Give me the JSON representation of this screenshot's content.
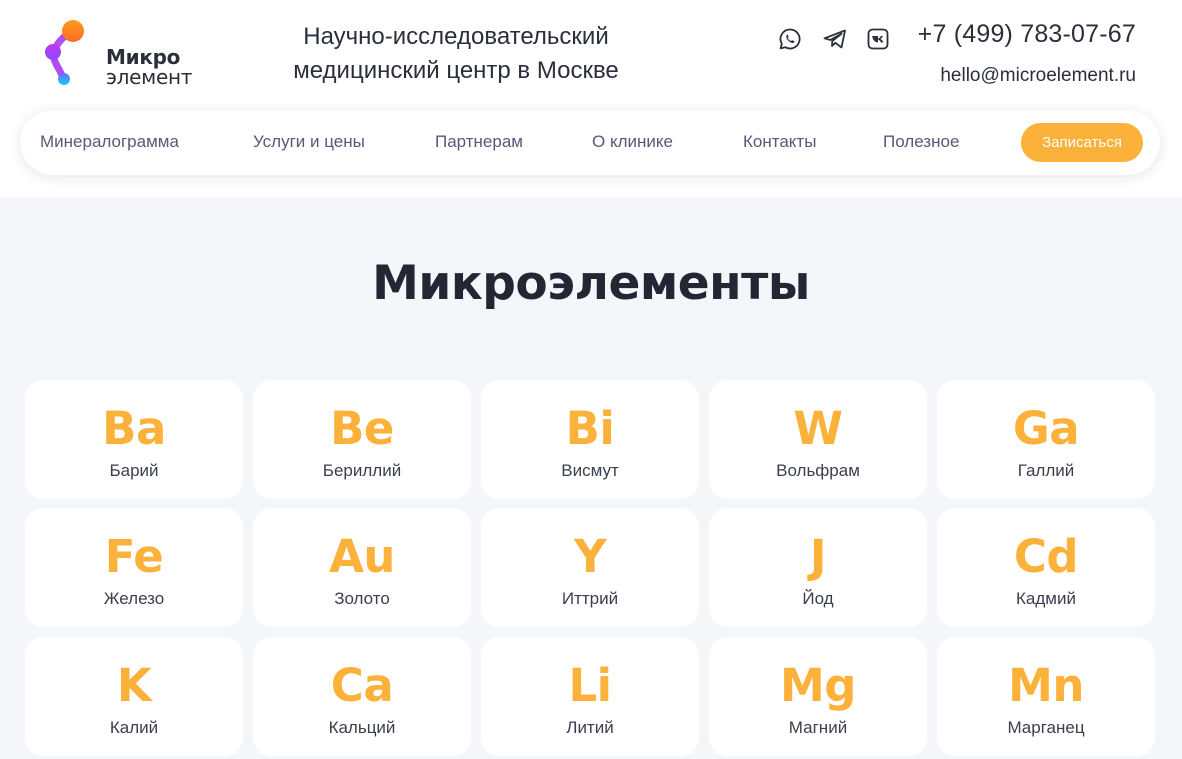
{
  "header": {
    "logo": {
      "line1": "Микро",
      "line2": "элемент"
    },
    "tagline_line1": "Научно-исследовательский",
    "tagline_line2": "медицинский центр в Москве",
    "socials": [
      {
        "icon": "whatsapp-icon"
      },
      {
        "icon": "telegram-icon"
      },
      {
        "icon": "vk-icon"
      }
    ],
    "phone": "+7 (499) 783-07-67",
    "email": "hello@microelement.ru"
  },
  "nav": {
    "items": [
      {
        "label": "Минералограмма"
      },
      {
        "label": "Услуги и цены"
      },
      {
        "label": "Партнерам"
      },
      {
        "label": "О клинике"
      },
      {
        "label": "Контакты"
      },
      {
        "label": "Полезное"
      }
    ],
    "cta_label": "Записаться"
  },
  "main": {
    "title": "Микроэлементы",
    "elements": [
      {
        "symbol": "Ba",
        "name": "Барий"
      },
      {
        "symbol": "Be",
        "name": "Бериллий"
      },
      {
        "symbol": "Bi",
        "name": "Висмут"
      },
      {
        "symbol": "W",
        "name": "Вольфрам"
      },
      {
        "symbol": "Ga",
        "name": "Галлий"
      },
      {
        "symbol": "Fe",
        "name": "Железо"
      },
      {
        "symbol": "Au",
        "name": "Золото"
      },
      {
        "symbol": "Y",
        "name": "Иттрий"
      },
      {
        "symbol": "J",
        "name": "Йод"
      },
      {
        "symbol": "Cd",
        "name": "Кадмий"
      },
      {
        "symbol": "K",
        "name": "Калий"
      },
      {
        "symbol": "Ca",
        "name": "Кальций"
      },
      {
        "symbol": "Li",
        "name": "Литий"
      },
      {
        "symbol": "Mg",
        "name": "Магний"
      },
      {
        "symbol": "Mn",
        "name": "Марганец"
      }
    ]
  },
  "colors": {
    "accent": "#fbb13a",
    "page_background": "#f5f6fa",
    "text_dark": "#222733",
    "nav_text": "#555a78"
  }
}
